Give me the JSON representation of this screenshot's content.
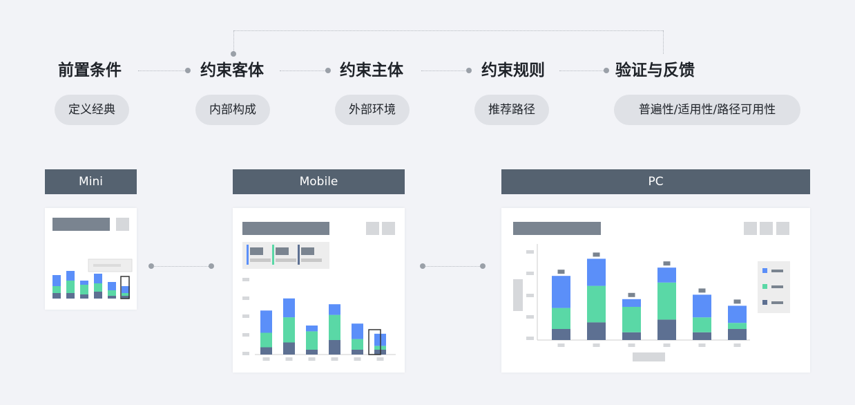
{
  "steps": [
    {
      "title": "前置条件",
      "tag": "定义经典"
    },
    {
      "title": "约束客体",
      "tag": "内部构成"
    },
    {
      "title": "约束主体",
      "tag": "外部环境"
    },
    {
      "title": "约束规则",
      "tag": "推荐路径"
    },
    {
      "title": "验证与反馈",
      "tag": "普遍性/适用性/路径可用性"
    }
  ],
  "devices": {
    "mini": "Mini",
    "mobile": "Mobile",
    "pc": "PC"
  },
  "colors": {
    "series_top": "#5b8ff9",
    "series_mid": "#5ad8a6",
    "series_bottom": "#5d7092",
    "header_bg": "#556270",
    "placeholder_bar": "#7a8490",
    "placeholder_light": "#d6d8db"
  },
  "chart_data": [
    {
      "type": "bar",
      "stacked": true,
      "device": "Mini",
      "series": [
        {
          "values": [
            2,
            2,
            1.5,
            2.5,
            1,
            1
          ]
        },
        {
          "values": [
            2.5,
            4.5,
            3.5,
            3,
            2,
            1
          ]
        },
        {
          "values": [
            4,
            3.5,
            1.5,
            3.5,
            3,
            2.5
          ]
        }
      ]
    },
    {
      "type": "bar",
      "stacked": true,
      "device": "Mobile",
      "series": [
        {
          "values": [
            1.5,
            2.5,
            1,
            3,
            1,
            1
          ]
        },
        {
          "values": [
            3,
            5.2,
            3.8,
            5.2,
            2.2,
            0.8
          ]
        },
        {
          "values": [
            4.6,
            3.9,
            1.2,
            2.2,
            3.2,
            2.5
          ]
        }
      ]
    },
    {
      "type": "bar",
      "stacked": true,
      "device": "PC",
      "series": [
        {
          "values": [
            2,
            3.2,
            1.4,
            3.7,
            1.4,
            2
          ]
        },
        {
          "values": [
            3.8,
            6.6,
            4.6,
            6.7,
            2.7,
            1.1
          ]
        },
        {
          "values": [
            5.8,
            4.9,
            1.4,
            2.7,
            4.1,
            3.1
          ]
        }
      ]
    }
  ]
}
